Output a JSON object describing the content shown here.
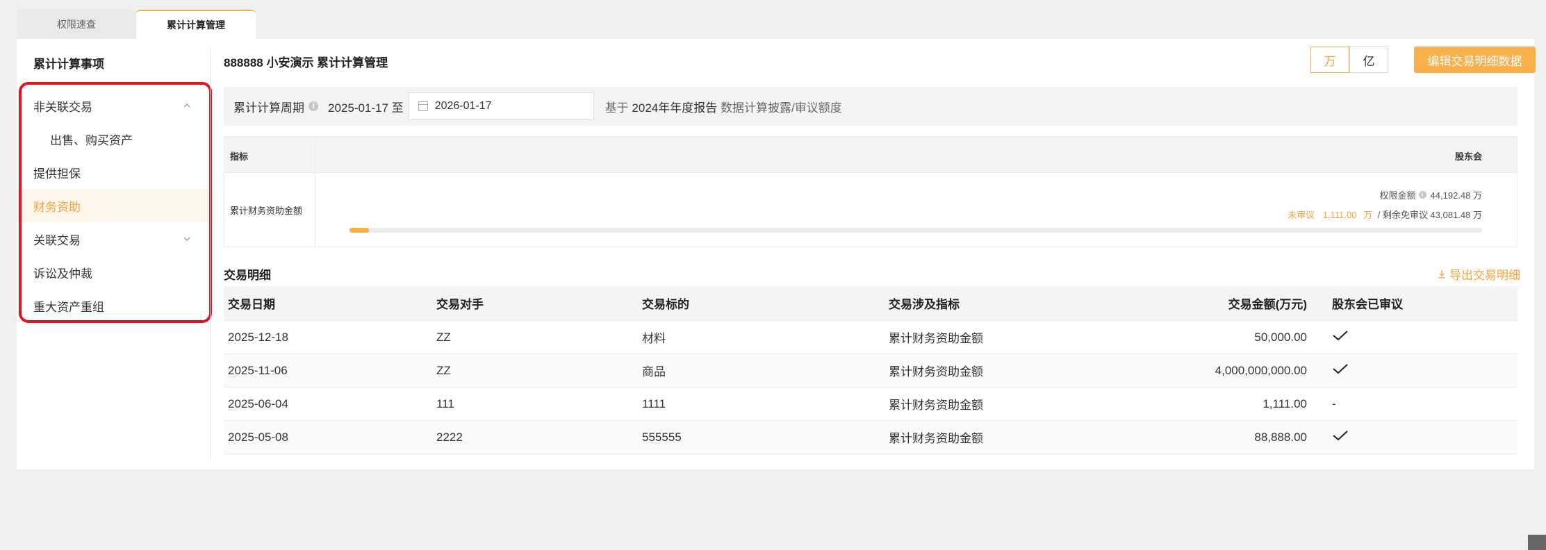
{
  "tabs": [
    {
      "label": "权限速查"
    },
    {
      "label": "累计计算管理"
    }
  ],
  "sidebar": {
    "title": "累计计算事项",
    "items": [
      {
        "label": "非关联交易"
      },
      {
        "label": "出售、购买资产"
      },
      {
        "label": "提供担保"
      },
      {
        "label": "财务资助"
      },
      {
        "label": "关联交易"
      },
      {
        "label": "诉讼及仲裁"
      },
      {
        "label": "重大资产重组"
      }
    ]
  },
  "header": {
    "title": "888888 小安演示 累计计算管理",
    "unit_wan": "万",
    "unit_yi": "亿",
    "edit_label": "编辑交易明细数据"
  },
  "period": {
    "label": "累计计算周期",
    "start": "2025-01-17 至",
    "end": "2026-01-17",
    "note_prefix": "基于",
    "note_report": "2024年年度报告",
    "note_suffix": "数据计算披露/审议额度"
  },
  "indicator": {
    "col1": "指标",
    "col2": "股东会",
    "row_label": "累计财务资助金额",
    "limit_label": "权限金额",
    "limit_value": "44,192.48 万",
    "pending_label": "未审议",
    "pending_value": "1,111.00",
    "pending_unit": "万",
    "remain_text": "/ 剩余免审议 43,081.48 万",
    "progress": 0.0174
  },
  "detail": {
    "title": "交易明细",
    "export_label": "导出交易明细",
    "columns": [
      "交易日期",
      "交易对手",
      "交易标的",
      "交易涉及指标",
      "交易金额(万元)",
      "股东会已审议"
    ],
    "rows": [
      {
        "date": "2025-12-18",
        "party": "ZZ",
        "target": "材料",
        "indicator": "累计财务资助金额",
        "amount": "50,000.00",
        "approved": true
      },
      {
        "date": "2025-11-06",
        "party": "ZZ",
        "target": "商品",
        "indicator": "累计财务资助金额",
        "amount": "4,000,000,000.00",
        "approved": true
      },
      {
        "date": "2025-06-04",
        "party": "111",
        "target": "1111",
        "indicator": "累计财务资助金额",
        "amount": "1,111.00",
        "approved": false,
        "approved_text": "-"
      },
      {
        "date": "2025-05-08",
        "party": "2222",
        "target": "555555",
        "indicator": "累计财务资助金额",
        "amount": "88,888.00",
        "approved": true
      }
    ]
  },
  "colors": {
    "accent": "#f7b046",
    "accent_text": "#f7a13b",
    "highlight_border": "#e8121d"
  }
}
